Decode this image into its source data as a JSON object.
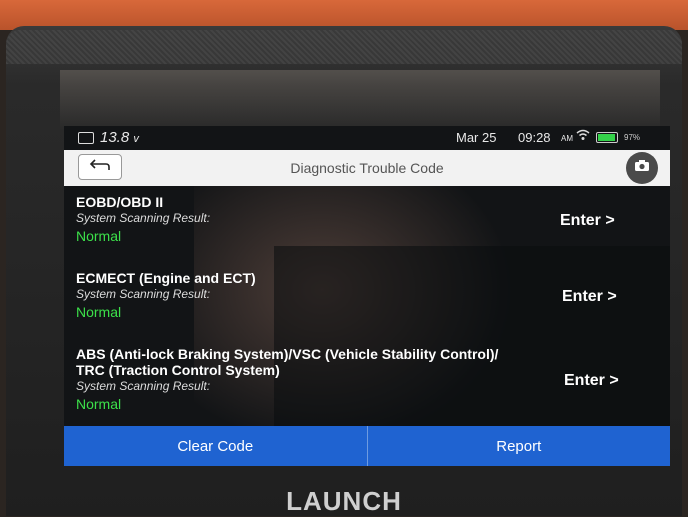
{
  "device": {
    "brand": "LAUNCH"
  },
  "statusbar": {
    "voltage": "13.8",
    "voltage_unit": "v",
    "date": "Mar 25",
    "time": "09:28",
    "ampm": "AM",
    "battery_percent": "97%",
    "battery_level": 0.97
  },
  "header": {
    "title": "Diagnostic Trouble Code"
  },
  "systems": [
    {
      "name": "EOBD/OBD II",
      "subtitle": "System Scanning Result:",
      "status": "Normal",
      "action": "Enter >"
    },
    {
      "name": "ECMECT (Engine and ECT)",
      "subtitle": "System Scanning Result:",
      "status": "Normal",
      "action": "Enter >"
    },
    {
      "name_line1": "ABS (Anti-lock Braking System)/VSC (Vehicle Stability Control)/",
      "name_line2": "TRC (Traction Control System)",
      "subtitle": "System Scanning Result:",
      "status": "Normal",
      "action": "Enter >"
    }
  ],
  "footer": {
    "clear_label": "Clear Code",
    "report_label": "Report"
  },
  "colors": {
    "status_ok": "#3ce04a",
    "footer_bar": "#1f63d1",
    "frame": "#c95c31"
  },
  "icons": [
    "car-battery-icon",
    "wifi-icon",
    "battery-icon",
    "back-arrow-icon",
    "camera-icon"
  ]
}
